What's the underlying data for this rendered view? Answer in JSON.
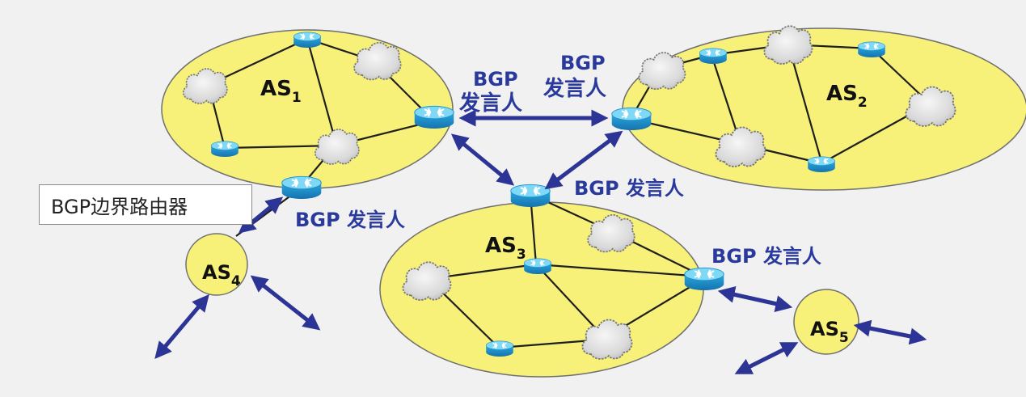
{
  "as_labels": {
    "as1": {
      "main": "AS",
      "sub": "1"
    },
    "as2": {
      "main": "AS",
      "sub": "2"
    },
    "as3": {
      "main": "AS",
      "sub": "3"
    },
    "as4": {
      "main": "AS",
      "sub": "4"
    },
    "as5": {
      "main": "AS",
      "sub": "5"
    }
  },
  "speaker_labels": {
    "as1_bgp": "BGP",
    "as1_role": "发言人",
    "as2_bgp": "BGP",
    "as2_role": "发言人",
    "as3_top": "BGP 发言人",
    "as1_bottom": "BGP 发言人",
    "as3_right": "BGP 发言人"
  },
  "callout": {
    "text": "BGP边界路由器"
  },
  "colors": {
    "as_fill": "#f7f17a",
    "as_stroke": "#6f6f6f",
    "link": "#1f1f1f",
    "arrow": "#2c3496",
    "speaker_text": "#2a3a9c",
    "router_top": "#6fd0f0",
    "router_body": "#1d8fc9"
  }
}
